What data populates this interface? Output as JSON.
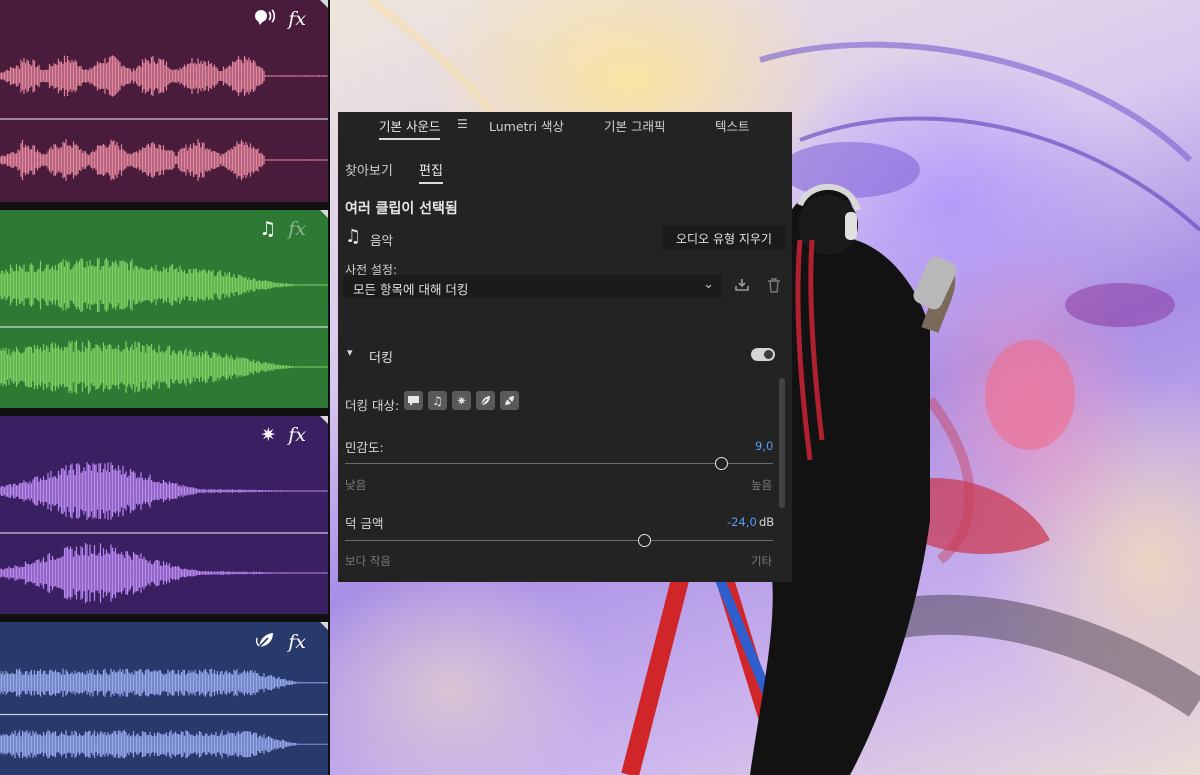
{
  "tracks": [
    {
      "name": "dialogue",
      "bg": "#4a1c3c",
      "wave": "#e3869d",
      "icon": "dialogue-icon",
      "fx_dim": false
    },
    {
      "name": "music",
      "bg": "#2e7a35",
      "wave": "#7fcf62",
      "icon": "music-note-icon",
      "fx_dim": true
    },
    {
      "name": "sfx",
      "bg": "#3b1f63",
      "wave": "#b889ef",
      "icon": "sparkle-icon",
      "fx_dim": false
    },
    {
      "name": "ambience",
      "bg": "#283a6b",
      "wave": "#97a9ec",
      "icon": "ambience-icon",
      "fx_dim": false
    }
  ],
  "fx_label": "fx",
  "panel": {
    "tabs": [
      "기본 사운드",
      "Lumetri 색상",
      "기본 그래픽",
      "텍스트"
    ],
    "active_tab": 0,
    "subtabs": [
      "찾아보기",
      "편집"
    ],
    "active_subtab": 1,
    "selection_heading": "여러 클립이 선택됨",
    "audio_type": "음악",
    "clear_button": "오디오 유형 지우기",
    "preset_label": "사전 설정:",
    "preset_value": "모든 항목에 대해 더킹",
    "section_title": "더킹",
    "section_enabled": true,
    "duck_target_label": "더킹 대상:",
    "duck_target_icons": [
      "dialogue-icon",
      "music-note-icon",
      "sparkle-icon",
      "ambience-icon",
      "unassigned-icon"
    ],
    "sensitivity": {
      "label": "민감도:",
      "value": "9,0",
      "fraction": 0.88,
      "low": "낮음",
      "high": "높음"
    },
    "duck_amount": {
      "label": "덕 금액",
      "value": "-24,0",
      "unit": "dB",
      "fraction": 0.7,
      "low": "보다 작음",
      "high": "기타"
    }
  },
  "colors": {
    "panel_bg": "#232323",
    "accent_value": "#5a9cf0"
  }
}
